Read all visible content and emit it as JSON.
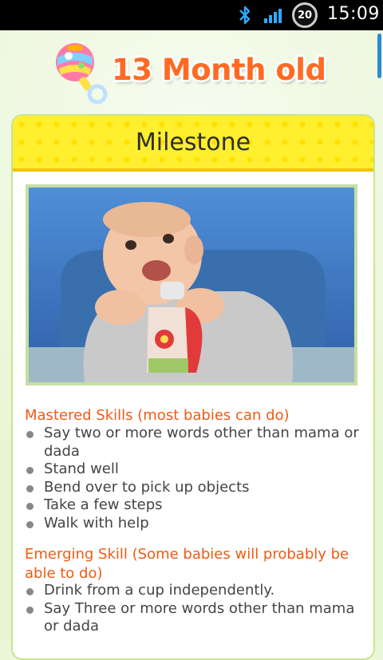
{
  "status_bar": {
    "battery_level": "20",
    "time": "15:09"
  },
  "header": {
    "title": "13 Month old"
  },
  "card": {
    "title": "Milestone"
  },
  "sections": [
    {
      "heading": "Mastered Skills (most babies can do)",
      "items": [
        "Say two or more words other than mama or dada",
        "Stand well",
        "Bend over to pick up objects",
        "Take a few steps",
        "Walk with help"
      ]
    },
    {
      "heading": "Emerging Skill (Some babies will probably be able to do)",
      "items": [
        "Drink from a cup independently.",
        "Say Three or more words other than mama or dada"
      ]
    }
  ],
  "colors": {
    "accent_orange": "#ff6a23",
    "heading_orange": "#f05a12",
    "header_yellow": "#ffef2e",
    "background_green": "#eaf6d8",
    "scroll_blue": "#2a8ad8"
  }
}
